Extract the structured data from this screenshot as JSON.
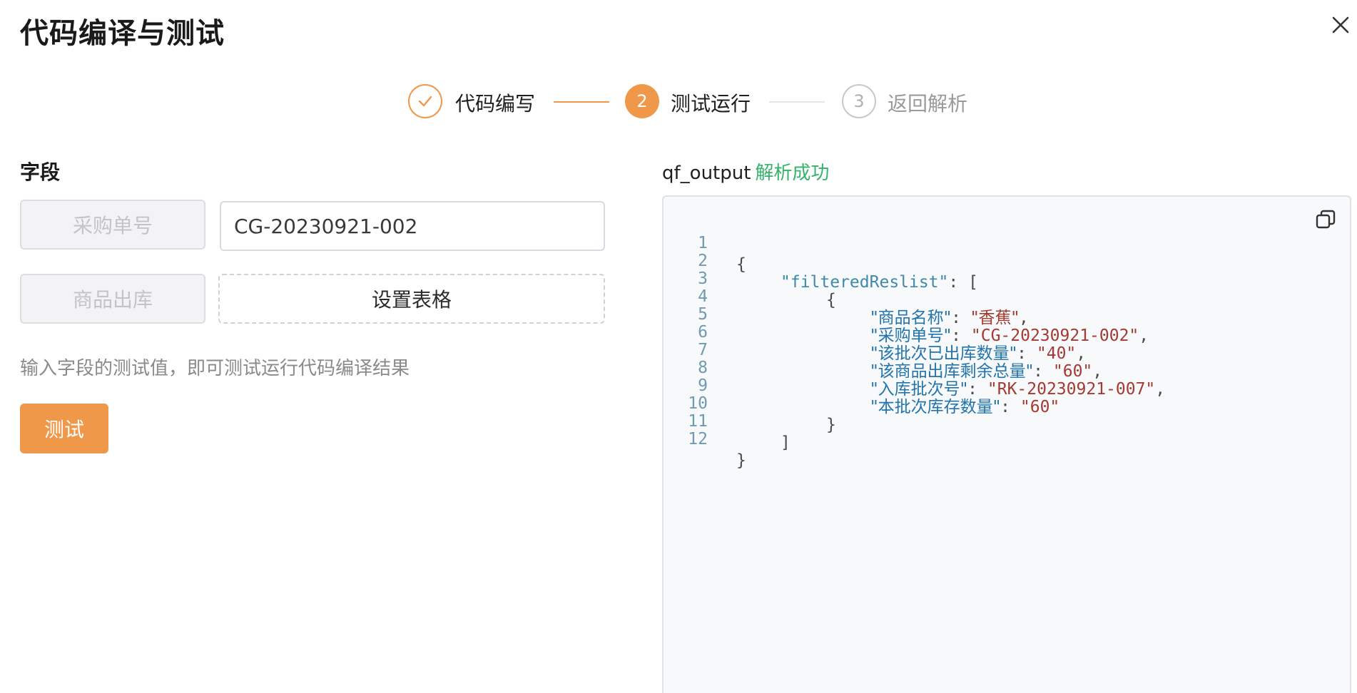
{
  "dialog": {
    "title": "代码编译与测试"
  },
  "steps": [
    {
      "label": "代码编写",
      "state": "done"
    },
    {
      "number": "2",
      "label": "测试运行",
      "state": "active"
    },
    {
      "number": "3",
      "label": "返回解析",
      "state": "pending"
    }
  ],
  "form": {
    "section_title": "字段",
    "fields": [
      {
        "label": "采购单号",
        "value": "CG-20230921-002"
      },
      {
        "label": "商品出库",
        "button": "设置表格"
      }
    ],
    "hint": "输入字段的测试值，即可测试运行代码编译结果",
    "test_button": "测试"
  },
  "output": {
    "name": "qf_output",
    "status": "解析成功",
    "lines": [
      {
        "n": "1",
        "text": "{"
      },
      {
        "n": "2",
        "key": "\"filteredReslist\"",
        "rest": ": ["
      },
      {
        "n": "3",
        "text": "{"
      },
      {
        "n": "4",
        "key": "\"商品名称\"",
        "value": "\"香蕉\"",
        "tail": ","
      },
      {
        "n": "5",
        "key": "\"采购单号\"",
        "value": "\"CG-20230921-002\"",
        "tail": ","
      },
      {
        "n": "6",
        "key": "\"该批次已出库数量\"",
        "value": "\"40\"",
        "tail": ","
      },
      {
        "n": "7",
        "key": "\"该商品出库剩余总量\"",
        "value": "\"60\"",
        "tail": ","
      },
      {
        "n": "8",
        "key": "\"入库批次号\"",
        "value": "\"RK-20230921-007\"",
        "tail": ","
      },
      {
        "n": "9",
        "key": "\"本批次库存数量\"",
        "value": "\"60\"",
        "tail": ""
      },
      {
        "n": "10",
        "text": "}"
      },
      {
        "n": "11",
        "text": "]"
      },
      {
        "n": "12",
        "text": "}"
      }
    ]
  },
  "colors": {
    "accent": "#f0984a",
    "success": "#35b36b",
    "json_key": "#3f8aa8",
    "json_string": "#a43a32"
  }
}
